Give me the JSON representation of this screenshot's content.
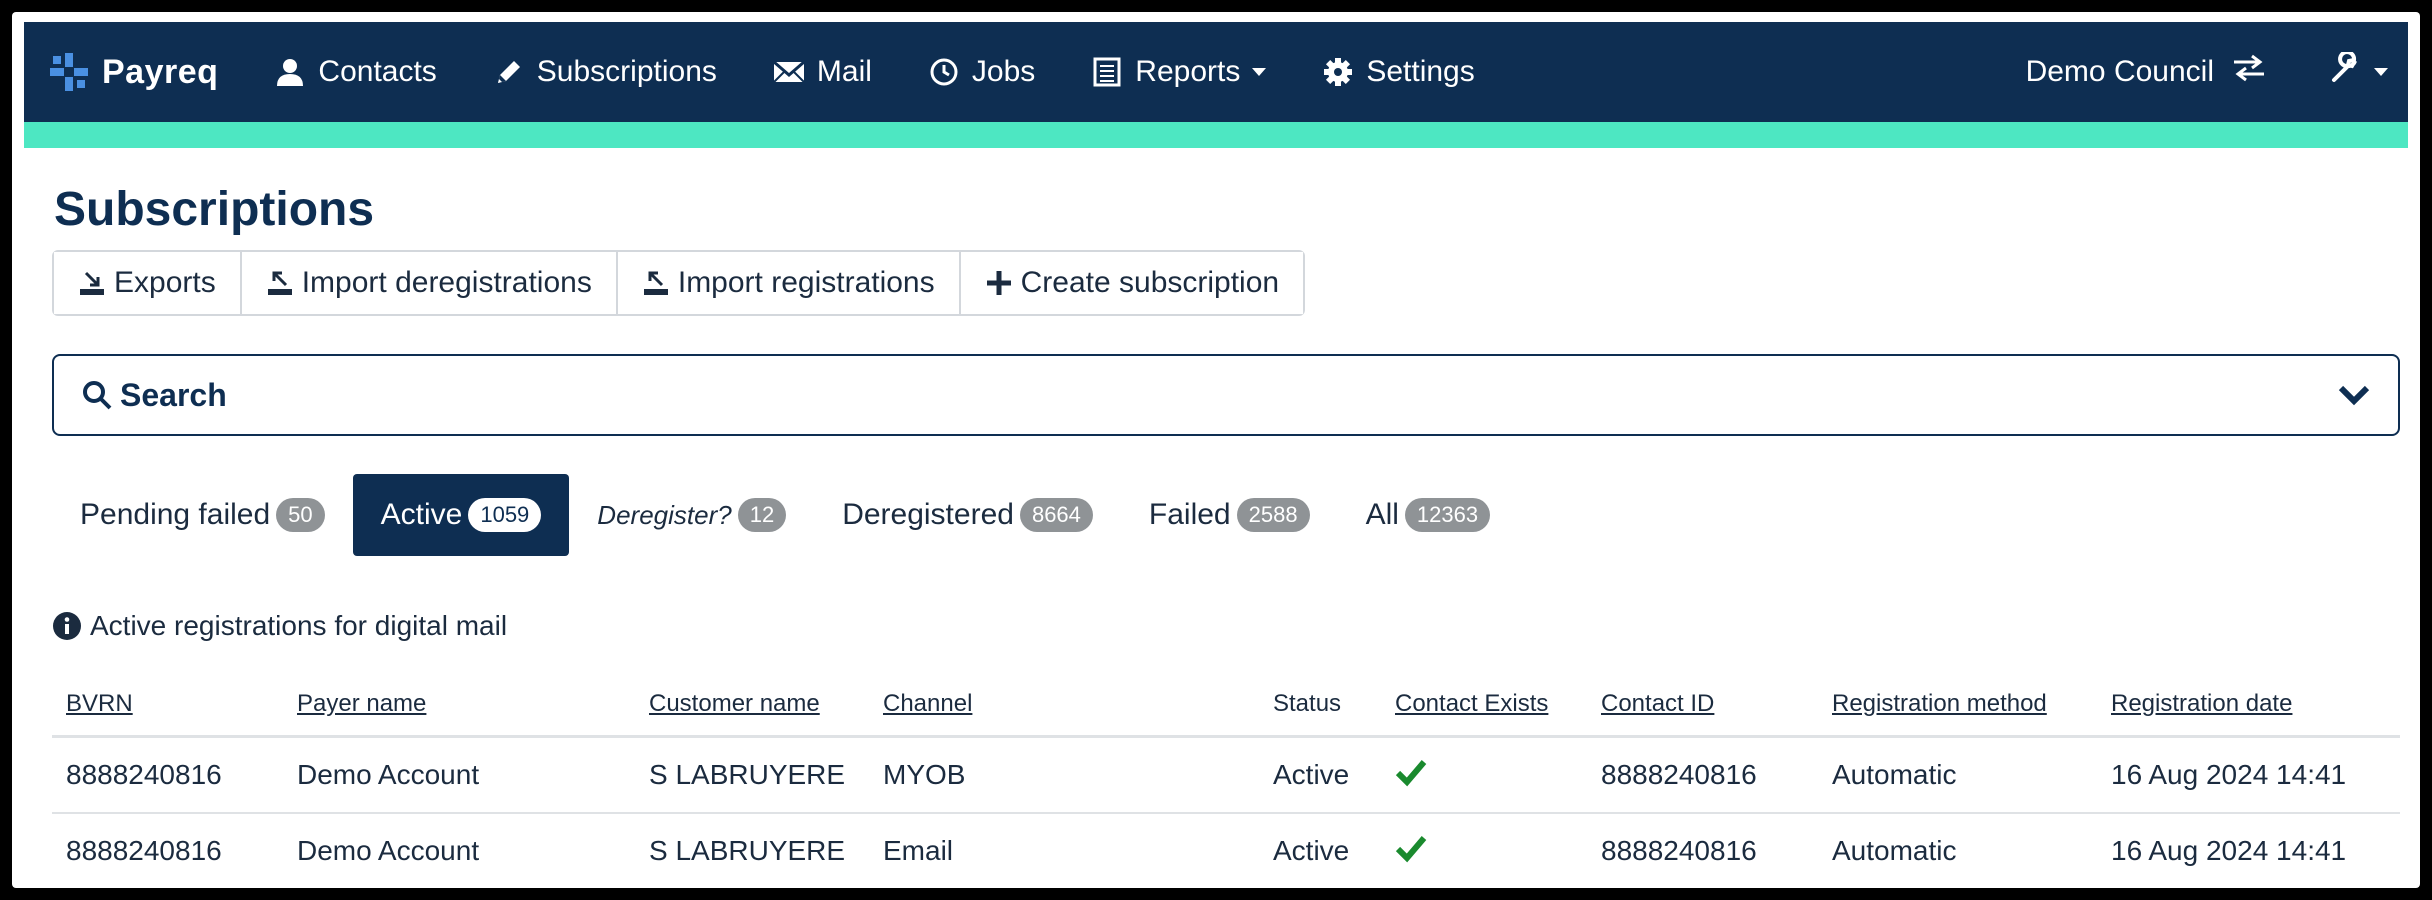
{
  "brand": {
    "name": "Payreq",
    "accent_color": "#4de7c2",
    "primary_color": "#0e2e52"
  },
  "nav": {
    "items": [
      {
        "label": "Contacts",
        "icon": "user-icon"
      },
      {
        "label": "Subscriptions",
        "icon": "pencil-icon"
      },
      {
        "label": "Mail",
        "icon": "envelope-icon"
      },
      {
        "label": "Jobs",
        "icon": "clock-icon"
      },
      {
        "label": "Reports",
        "icon": "report-icon",
        "dropdown": true
      },
      {
        "label": "Settings",
        "icon": "gear-icon"
      }
    ],
    "org_name": "Demo Council",
    "org_icon": "swap-icon",
    "tools_icon": "wrench-icon"
  },
  "page": {
    "title": "Subscriptions",
    "actions": [
      {
        "label": "Exports",
        "icon": "download-icon"
      },
      {
        "label": "Import deregistrations",
        "icon": "upload-icon"
      },
      {
        "label": "Import registrations",
        "icon": "upload-icon"
      },
      {
        "label": "Create subscription",
        "icon": "plus-icon"
      }
    ],
    "search_label": "Search",
    "tabs": [
      {
        "label": "Pending failed",
        "count": "50"
      },
      {
        "label": "Active",
        "count": "1059",
        "active": true
      },
      {
        "label": "Deregister?",
        "count": "12",
        "italic": true
      },
      {
        "label": "Deregistered",
        "count": "8664"
      },
      {
        "label": "Failed",
        "count": "2588"
      },
      {
        "label": "All",
        "count": "12363"
      }
    ],
    "info_text": "Active registrations for digital mail"
  },
  "table": {
    "headers": [
      "BVRN",
      "Payer name",
      "Customer name",
      "Channel",
      "Status",
      "Contact Exists",
      "Contact ID",
      "Registration method",
      "Registration date"
    ],
    "rows": [
      [
        "8888240816",
        "Demo Account",
        "S LABRUYERE",
        "MYOB",
        "Active",
        "check",
        "8888240816",
        "Automatic",
        "16 Aug 2024 14:41"
      ],
      [
        "8888240816",
        "Demo Account",
        "S LABRUYERE",
        "Email",
        "Active",
        "check",
        "8888240816",
        "Automatic",
        "16 Aug 2024 14:41"
      ]
    ]
  }
}
